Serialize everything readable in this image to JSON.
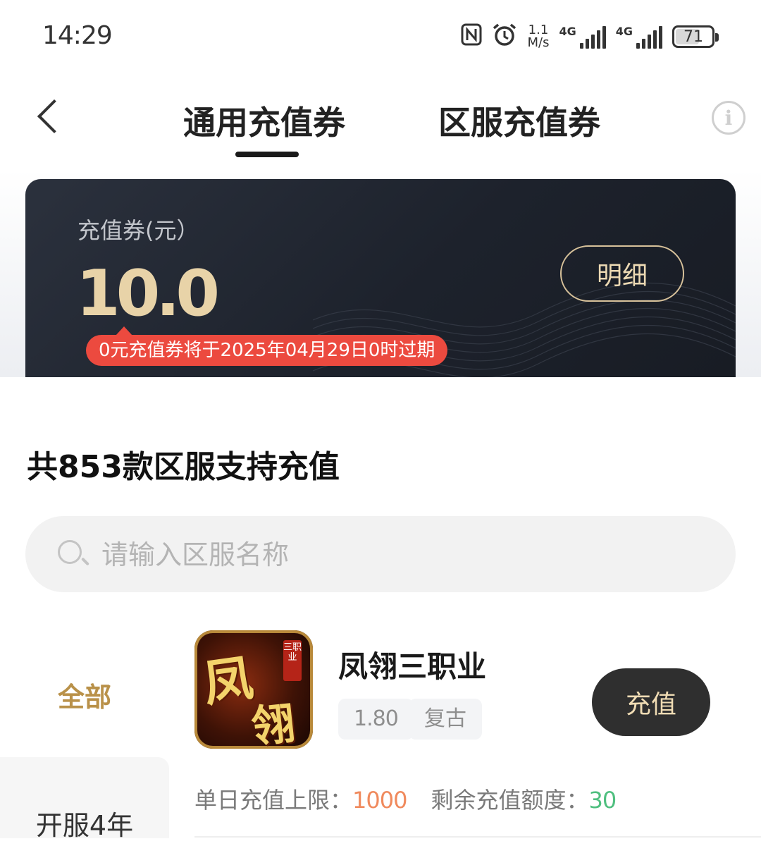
{
  "status_bar": {
    "time": "14:29",
    "net_speed_value": "1.1",
    "net_speed_unit": "M/s",
    "signal1_label": "4G",
    "signal2_label": "4G",
    "battery": "71",
    "icons": [
      "nfc-icon",
      "alarm-icon",
      "signal-icon",
      "battery-icon"
    ]
  },
  "nav": {
    "tabs": [
      {
        "label": "通用充值券",
        "active": true
      },
      {
        "label": "区服充值券",
        "active": false
      }
    ],
    "info_symbol": "i"
  },
  "voucher": {
    "label": "充值券(元）",
    "amount": "10.0",
    "detail_button": "明细",
    "expire_notice": "0元充值券将于2025年04月29日0时过期"
  },
  "server_list": {
    "title": "共853款区服支持充值",
    "search_placeholder": "请输入区服名称",
    "categories": [
      {
        "label": "全部",
        "active": true
      },
      {
        "label": "开服4年",
        "active": false
      }
    ],
    "games": [
      {
        "name": "凤翎三职业",
        "icon_text_1": "凤",
        "icon_text_2": "翎",
        "icon_badge": "三职业",
        "tags": [
          "1.80",
          "复古"
        ],
        "button": "充值",
        "daily_limit_label": "单日充值上限：",
        "daily_limit_value": "1000",
        "remaining_label": "剩余充值额度：",
        "remaining_value": "30"
      }
    ]
  },
  "colors": {
    "accent_gold": "#b99149",
    "card_dark": "#1d222c",
    "expire_red": "#ec4a3f",
    "limit_orange": "#f08a5d",
    "remain_green": "#4fbf7f"
  }
}
